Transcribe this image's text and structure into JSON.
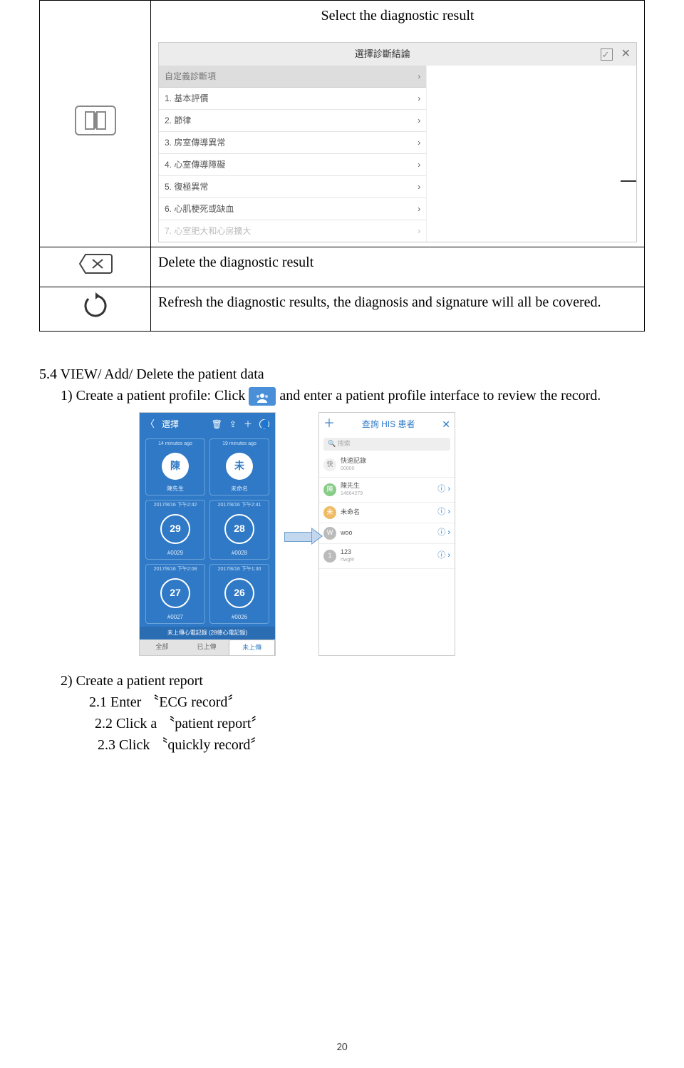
{
  "row1": {
    "caption": "Select the diagnostic result",
    "shot": {
      "title": "選擇診斷結論",
      "header": "自定義診斷項",
      "items": [
        "1. 基本評價",
        "2. 節律",
        "3. 房室傳導異常",
        "4. 心室傳導障礙",
        "5. 復極異常",
        "6. 心肌梗死或缺血",
        "7. 心室肥大和心房擴大"
      ]
    }
  },
  "row2": {
    "text": "Delete the diagnostic result"
  },
  "row3": {
    "text": "Refresh the diagnostic results, the diagnosis and signature will all be covered."
  },
  "section_heading": "5.4 VIEW/ Add/ Delete the patient data",
  "step1_a": "1) Create a patient profile: Click ",
  "step1_b": " and enter a patient profile interface to review the record.",
  "phone1": {
    "toolbar_label": "選擇",
    "cards": [
      {
        "ts": "14 minutes ago",
        "big": "陳",
        "lbl": "陳先生"
      },
      {
        "ts": "19 minutes ago",
        "big": "未",
        "lbl": "未命名"
      },
      {
        "ts": "2017/8/16 下午2:42",
        "big": "29",
        "lbl": "#0029"
      },
      {
        "ts": "2017/8/16 下午2:41",
        "big": "28",
        "lbl": "#0028"
      },
      {
        "ts": "2017/8/16 下午2:08",
        "big": "27",
        "lbl": "#0027"
      },
      {
        "ts": "2017/8/16 下午1:30",
        "big": "26",
        "lbl": "#0026"
      }
    ],
    "footnote": "未上傳心電記錄 (28條心電記錄)",
    "tabs": [
      "全部",
      "已上傳",
      "未上傳"
    ]
  },
  "phone2": {
    "header_center": "查詢 HIS 患者",
    "search_ph": "搜索",
    "rows": [
      {
        "avclass": "qk",
        "av": "快",
        "nm": "快速記錄",
        "sub": "00000",
        "info": ""
      },
      {
        "avclass": "g",
        "av": "陳",
        "nm": "陳先生",
        "sub": "14664279",
        "info": "ⓘ ›"
      },
      {
        "avclass": "y",
        "av": "未",
        "nm": "未命名",
        "sub": "",
        "info": "ⓘ ›"
      },
      {
        "avclass": "",
        "av": "W",
        "nm": "woo",
        "sub": "",
        "info": "ⓘ ›"
      },
      {
        "avclass": "",
        "av": "1",
        "nm": "123",
        "sub": "rtwgfé",
        "info": "ⓘ ›"
      }
    ]
  },
  "step2_head": "2)    Create a patient report",
  "step2_1": "2.1 Enter   〝ECG record〞",
  "step2_2": "2.2 Click a   〝patient report〞",
  "step2_3": "2.3 Click   〝quickly record〞",
  "page_number": "20"
}
